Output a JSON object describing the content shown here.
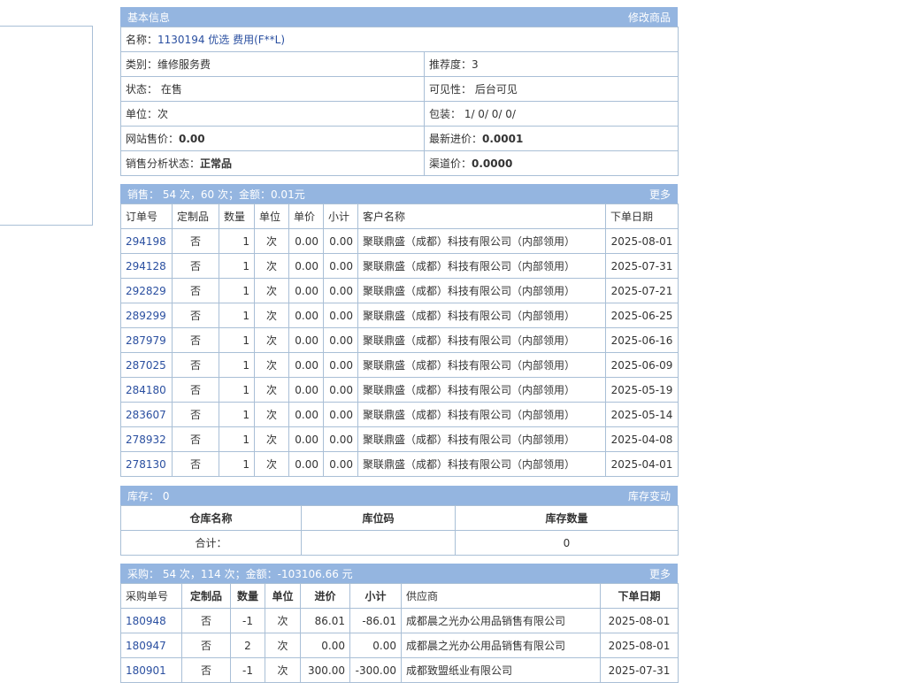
{
  "basic": {
    "title": "基本信息",
    "edit_label": "修改商品",
    "name_label": "名称：",
    "name_value": "1130194 优选 费用(F**L)",
    "category": "类别：维修服务费",
    "recommend": "推荐度：3",
    "status": "状态： 在售",
    "visibility": "可见性： 后台可见",
    "unit": "单位：次",
    "package": "包装： 1/ 0/ 0/ 0/",
    "site_price_label": "网站售价：",
    "site_price": "0.00",
    "latest_cost_label": "最新进价：",
    "latest_cost": "0.0001",
    "sales_status_label": "销售分析状态：",
    "sales_status": "正常品",
    "channel_price_label": "渠道价：",
    "channel_price": "0.0000"
  },
  "sales": {
    "title": "销售： 54 次，60 次；金额：0.01元",
    "more_label": "更多",
    "columns": [
      "订单号",
      "定制品",
      "数量",
      "单位",
      "单价",
      "小计",
      "客户名称",
      "下单日期"
    ],
    "rows": [
      [
        "294198",
        "否",
        "1",
        "次",
        "0.00",
        "0.00",
        "聚联鼎盛（成都）科技有限公司（内部领用）",
        "2025-08-01"
      ],
      [
        "294128",
        "否",
        "1",
        "次",
        "0.00",
        "0.00",
        "聚联鼎盛（成都）科技有限公司（内部领用）",
        "2025-07-31"
      ],
      [
        "292829",
        "否",
        "1",
        "次",
        "0.00",
        "0.00",
        "聚联鼎盛（成都）科技有限公司（内部领用）",
        "2025-07-21"
      ],
      [
        "289299",
        "否",
        "1",
        "次",
        "0.00",
        "0.00",
        "聚联鼎盛（成都）科技有限公司（内部领用）",
        "2025-06-25"
      ],
      [
        "287979",
        "否",
        "1",
        "次",
        "0.00",
        "0.00",
        "聚联鼎盛（成都）科技有限公司（内部领用）",
        "2025-06-16"
      ],
      [
        "287025",
        "否",
        "1",
        "次",
        "0.00",
        "0.00",
        "聚联鼎盛（成都）科技有限公司（内部领用）",
        "2025-06-09"
      ],
      [
        "284180",
        "否",
        "1",
        "次",
        "0.00",
        "0.00",
        "聚联鼎盛（成都）科技有限公司（内部领用）",
        "2025-05-19"
      ],
      [
        "283607",
        "否",
        "1",
        "次",
        "0.00",
        "0.00",
        "聚联鼎盛（成都）科技有限公司（内部领用）",
        "2025-05-14"
      ],
      [
        "278932",
        "否",
        "1",
        "次",
        "0.00",
        "0.00",
        "聚联鼎盛（成都）科技有限公司（内部领用）",
        "2025-04-08"
      ],
      [
        "278130",
        "否",
        "1",
        "次",
        "0.00",
        "0.00",
        "聚联鼎盛（成都）科技有限公司（内部领用）",
        "2025-04-01"
      ]
    ]
  },
  "stock": {
    "title": "库存： 0",
    "change_label": "库存变动",
    "columns": [
      "仓库名称",
      "库位码",
      "库存数量"
    ],
    "total_label": "合计：",
    "total_location": "",
    "total_qty": "0"
  },
  "purchase": {
    "title": "采购： 54 次，114 次；金额：-103106.66 元",
    "more_label": "更多",
    "columns": [
      "采购单号",
      "定制品",
      "数量",
      "单位",
      "进价",
      "小计",
      "供应商",
      "下单日期"
    ],
    "rows": [
      [
        "180948",
        "否",
        "-1",
        "次",
        "86.01",
        "-86.01",
        "成都晨之光办公用品销售有限公司",
        "2025-08-01"
      ],
      [
        "180947",
        "否",
        "2",
        "次",
        "0.00",
        "0.00",
        "成都晨之光办公用品销售有限公司",
        "2025-08-01"
      ],
      [
        "180901",
        "否",
        "-1",
        "次",
        "300.00",
        "-300.00",
        "成都致盟纸业有限公司",
        "2025-07-31"
      ]
    ]
  }
}
